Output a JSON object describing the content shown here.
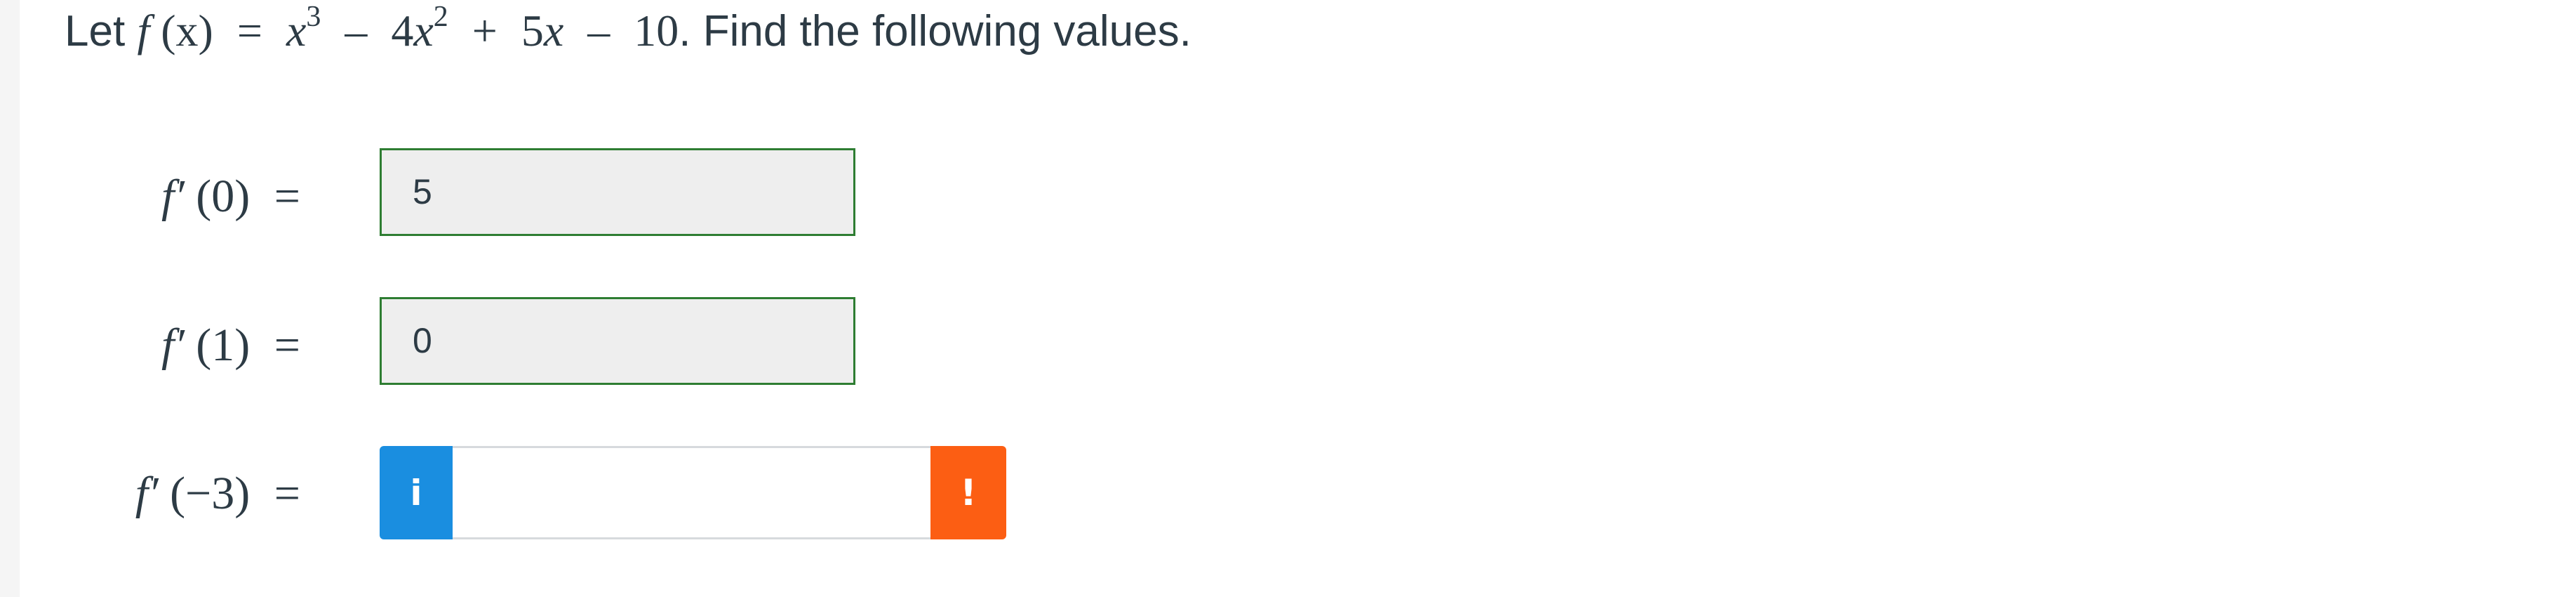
{
  "question": {
    "intro": "Let",
    "func": "f",
    "var": "(x)",
    "equals": "=",
    "t1_base": "x",
    "t1_exp": "3",
    "minus1": "–",
    "t2_coef": "4",
    "t2_base": "x",
    "t2_exp": "2",
    "plus": "+",
    "t3": "5",
    "t3_var": "x",
    "minus2": "–",
    "const": "10",
    "tail": ". Find the following values."
  },
  "rows": [
    {
      "fn": "f′",
      "arg": "(0)",
      "eq": "=",
      "value": "5"
    },
    {
      "fn": "f′",
      "arg": "(1)",
      "eq": "=",
      "value": "0"
    },
    {
      "fn": "f′",
      "arg": "(−3)",
      "eq": "=",
      "value": ""
    }
  ],
  "buttons": {
    "info_glyph": "i",
    "warn_glyph": "!"
  },
  "colors": {
    "correct_border": "#2e7d32",
    "info_blue": "#1a8ee0",
    "warning_orange": "#fc5e13",
    "filled_bg": "#eeeeee"
  },
  "icons": {
    "info": "info-icon",
    "warning": "warning-icon"
  }
}
